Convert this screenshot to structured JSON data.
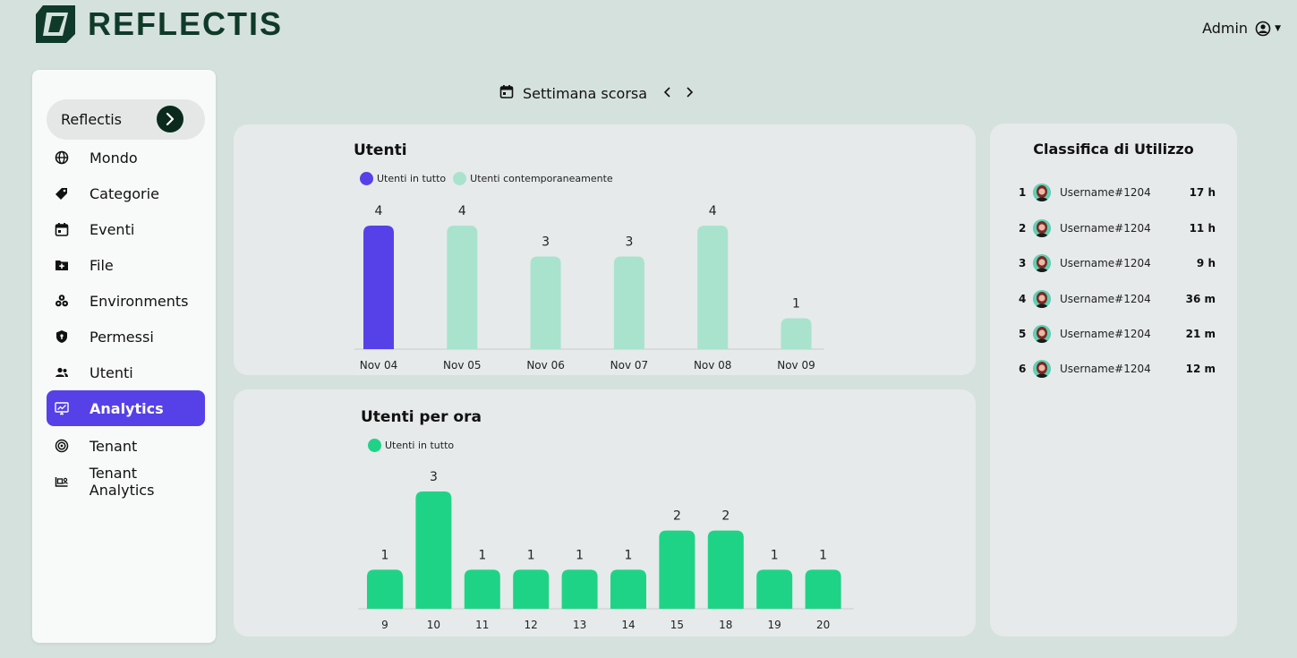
{
  "header": {
    "brand": "REFLECTIS",
    "user_label": "Admin"
  },
  "sidebar": {
    "world_select": "Reflectis",
    "items": [
      {
        "label": "Mondo",
        "icon": "globe-icon"
      },
      {
        "label": "Categorie",
        "icon": "tag-icon"
      },
      {
        "label": "Eventi",
        "icon": "calendar-icon"
      },
      {
        "label": "File",
        "icon": "folder-add-icon"
      },
      {
        "label": "Environments",
        "icon": "cubes-icon"
      },
      {
        "label": "Permessi",
        "icon": "shield-icon"
      },
      {
        "label": "Utenti",
        "icon": "users-icon"
      },
      {
        "label": "Analytics",
        "icon": "analytics-icon",
        "active": true
      },
      {
        "label": "Tenant",
        "icon": "target-icon"
      },
      {
        "label": "Tenant Analytics",
        "icon": "tenant-analytics-icon"
      }
    ]
  },
  "period": {
    "label": "Settimana scorsa"
  },
  "colors": {
    "accent": "#5641e8",
    "mint": "#a9e3cd",
    "green": "#1fd386",
    "brand_dark": "#0f3a29"
  },
  "chart_data": [
    {
      "type": "bar",
      "title": "Utenti",
      "legend": [
        "Utenti in tutto",
        "Utenti contemporaneamente"
      ],
      "categories": [
        "Nov 04",
        "Nov 05",
        "Nov 06",
        "Nov 07",
        "Nov 08",
        "Nov 09"
      ],
      "values": [
        4,
        4,
        3,
        3,
        4,
        1
      ],
      "bar_colors": [
        "#5641e8",
        "#a9e3cd",
        "#a9e3cd",
        "#a9e3cd",
        "#a9e3cd",
        "#a9e3cd"
      ],
      "ylim": [
        0,
        4
      ],
      "grid": false
    },
    {
      "type": "bar",
      "title": "Utenti per ora",
      "legend": [
        "Utenti in tutto"
      ],
      "categories": [
        "9",
        "10",
        "11",
        "12",
        "13",
        "14",
        "15",
        "18",
        "19",
        "20"
      ],
      "values": [
        1,
        3,
        1,
        1,
        1,
        1,
        2,
        2,
        1,
        1
      ],
      "ylim": [
        0,
        3
      ],
      "grid": false
    }
  ],
  "leaderboard": {
    "title": "Classifica di Utilizzo",
    "rows": [
      {
        "rank": "1",
        "name": "Username#1204",
        "time": "17 h"
      },
      {
        "rank": "2",
        "name": "Username#1204",
        "time": "11 h"
      },
      {
        "rank": "3",
        "name": "Username#1204",
        "time": "9 h"
      },
      {
        "rank": "4",
        "name": "Username#1204",
        "time": "36 m"
      },
      {
        "rank": "5",
        "name": "Username#1204",
        "time": "21 m"
      },
      {
        "rank": "6",
        "name": "Username#1204",
        "time": "12 m"
      }
    ]
  }
}
